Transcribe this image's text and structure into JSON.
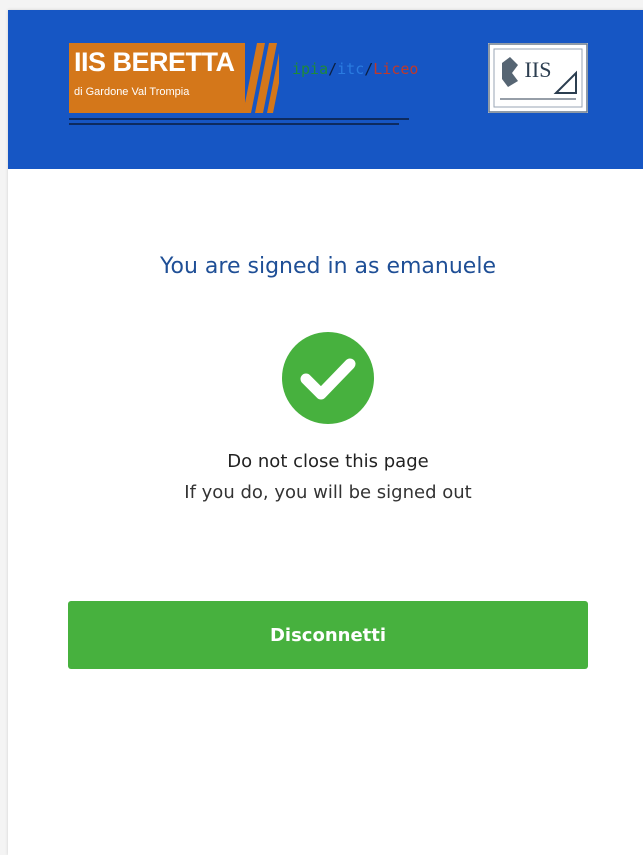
{
  "header": {
    "logo": {
      "title": "IIS BERETTA",
      "subtitle": "di Gardone Val Trompia"
    },
    "tagline": {
      "ipia": "ipia",
      "sep1": "/",
      "itc": "itc",
      "sep2": "/",
      "liceo": "Liceo"
    },
    "crest": {
      "text": "IIS"
    },
    "background_color": "#1656c4"
  },
  "main": {
    "signed_in_text": "You are signed in as emanuele",
    "success_icon": "check-circle-icon",
    "notice_title": "Do not close this page",
    "notice_subtitle": "If you do, you will be signed out",
    "disconnect_label": "Disconnetti"
  },
  "colors": {
    "accent_green": "#47b13e",
    "title_blue": "#1f4f96"
  }
}
